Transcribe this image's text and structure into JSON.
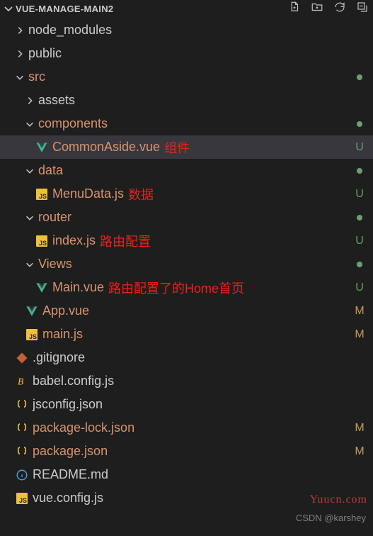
{
  "header": {
    "title": "VUE-MANAGE-MAIN2"
  },
  "actions": {
    "new_file": "new-file",
    "new_folder": "new-folder",
    "refresh": "refresh",
    "collapse": "collapse-all"
  },
  "tree": [
    {
      "depth": 0,
      "kind": "folder",
      "expanded": false,
      "name": "node_modules",
      "color": "default"
    },
    {
      "depth": 0,
      "kind": "folder",
      "expanded": false,
      "name": "public",
      "color": "default"
    },
    {
      "depth": 0,
      "kind": "folder",
      "expanded": true,
      "name": "src",
      "color": "orange",
      "status": "dot"
    },
    {
      "depth": 1,
      "kind": "folder",
      "expanded": false,
      "name": "assets",
      "color": "default"
    },
    {
      "depth": 1,
      "kind": "folder",
      "expanded": true,
      "name": "components",
      "color": "orange",
      "status": "dot"
    },
    {
      "depth": 2,
      "kind": "file",
      "icon": "vue",
      "name": "CommonAside.vue",
      "color": "orange",
      "annot": "组件",
      "status": "U",
      "selected": true
    },
    {
      "depth": 1,
      "kind": "folder",
      "expanded": true,
      "name": "data",
      "color": "orange",
      "status": "dot"
    },
    {
      "depth": 2,
      "kind": "file",
      "icon": "js",
      "name": "MenuData.js",
      "color": "orange",
      "annot": "数据",
      "status": "U"
    },
    {
      "depth": 1,
      "kind": "folder",
      "expanded": true,
      "name": "router",
      "color": "orange",
      "status": "dot"
    },
    {
      "depth": 2,
      "kind": "file",
      "icon": "js",
      "name": "index.js",
      "color": "orange",
      "annot": "路由配置",
      "status": "U"
    },
    {
      "depth": 1,
      "kind": "folder",
      "expanded": true,
      "name": "Views",
      "color": "orange",
      "status": "dot"
    },
    {
      "depth": 2,
      "kind": "file",
      "icon": "vue",
      "name": "Main.vue",
      "color": "orange",
      "annot": "路由配置了的Home首页",
      "status": "U"
    },
    {
      "depth": 1,
      "kind": "file",
      "icon": "vue",
      "name": "App.vue",
      "color": "orange",
      "status": "M"
    },
    {
      "depth": 1,
      "kind": "file",
      "icon": "js",
      "name": "main.js",
      "color": "orange",
      "status": "M"
    },
    {
      "depth": 0,
      "kind": "file",
      "icon": "git",
      "name": ".gitignore",
      "color": "default"
    },
    {
      "depth": 0,
      "kind": "file",
      "icon": "babel",
      "name": "babel.config.js",
      "color": "default"
    },
    {
      "depth": 0,
      "kind": "file",
      "icon": "json",
      "name": "jsconfig.json",
      "color": "default"
    },
    {
      "depth": 0,
      "kind": "file",
      "icon": "json",
      "name": "package-lock.json",
      "color": "orange",
      "status": "M"
    },
    {
      "depth": 0,
      "kind": "file",
      "icon": "json",
      "name": "package.json",
      "color": "orange",
      "status": "M"
    },
    {
      "depth": 0,
      "kind": "file",
      "icon": "info",
      "name": "README.md",
      "color": "default"
    },
    {
      "depth": 0,
      "kind": "file",
      "icon": "js",
      "name": "vue.config.js",
      "color": "default"
    }
  ],
  "watermarks": {
    "site": "Yuucn.com",
    "author": "CSDN @karshey"
  }
}
